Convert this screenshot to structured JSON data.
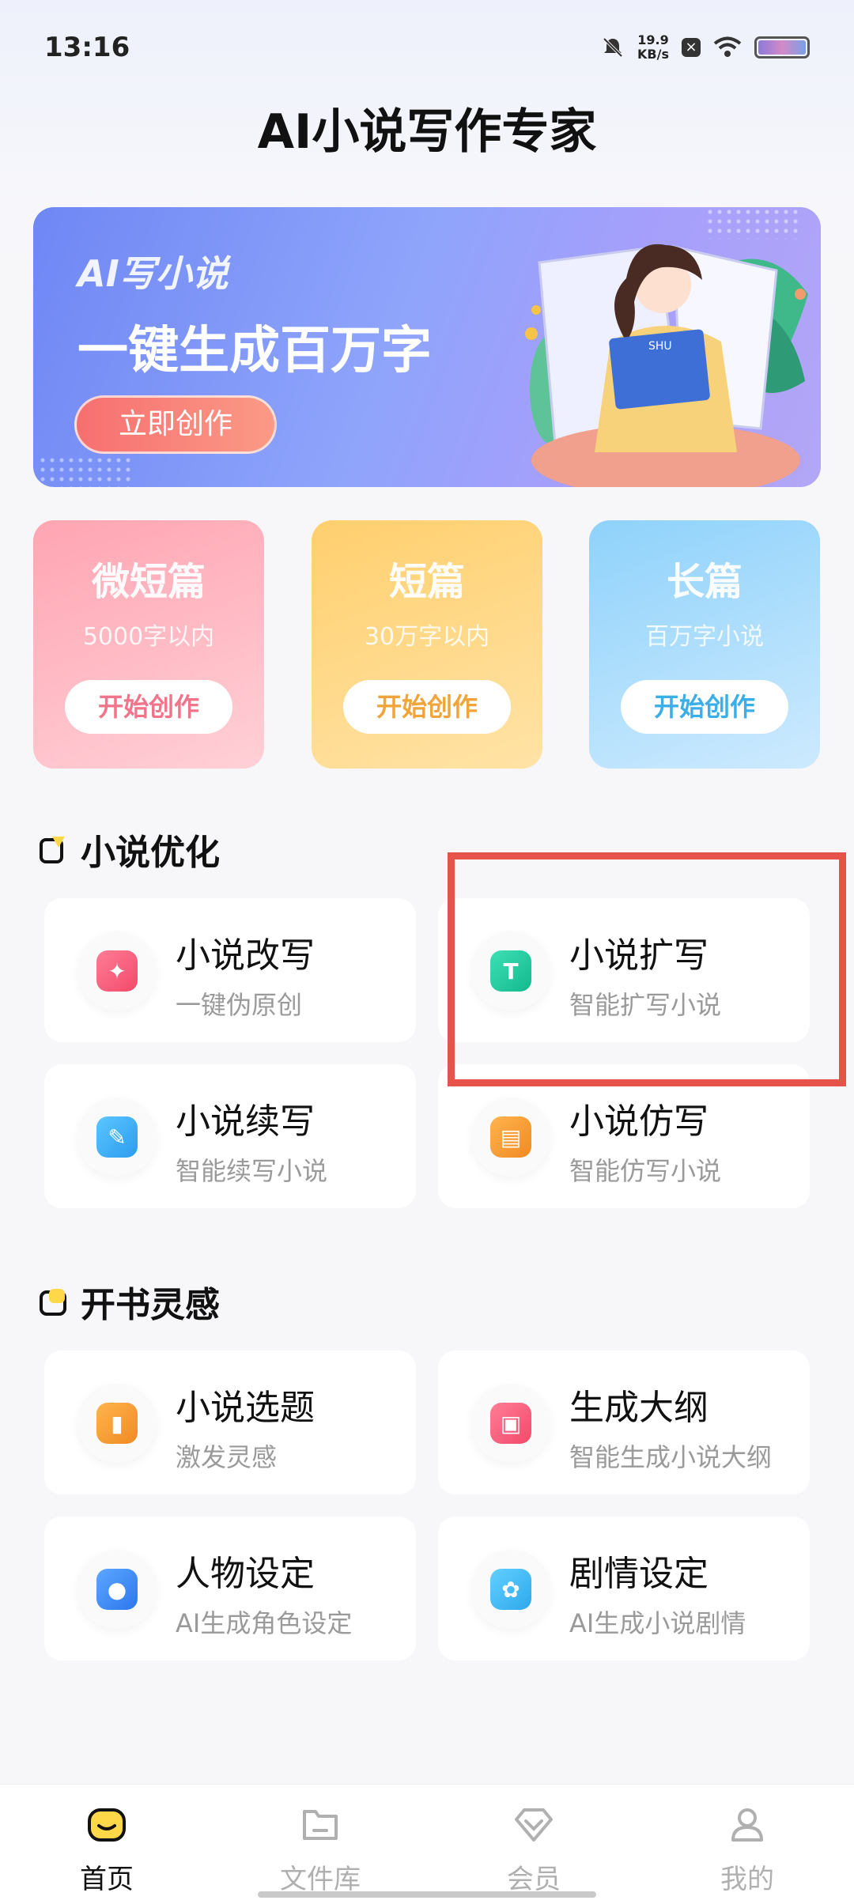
{
  "status_bar": {
    "time": "13:16",
    "net_speed_value": "19.9",
    "net_speed_unit": "KB/s"
  },
  "app_title": "AI小说写作专家",
  "banner": {
    "tag": "AI写小说",
    "headline": "一键生成百万字",
    "button": "立即创作"
  },
  "length_cards": [
    {
      "title": "微短篇",
      "subtitle": "5000字以内",
      "button": "开始创作",
      "accent": "#f2748a"
    },
    {
      "title": "短篇",
      "subtitle": "30万字以内",
      "button": "开始创作",
      "accent": "#f0a43a"
    },
    {
      "title": "长篇",
      "subtitle": "百万字小说",
      "button": "开始创作",
      "accent": "#3aaee8"
    }
  ],
  "sections": [
    {
      "title": "小说优化",
      "items": [
        {
          "title": "小说改写",
          "subtitle": "一键伪原创",
          "icon": "bulb-icon"
        },
        {
          "title": "小说扩写",
          "subtitle": "智能扩写小说",
          "icon": "expand-text-icon"
        },
        {
          "title": "小说续写",
          "subtitle": "智能续写小说",
          "icon": "pen-icon"
        },
        {
          "title": "小说仿写",
          "subtitle": "智能仿写小说",
          "icon": "copy-icon"
        }
      ]
    },
    {
      "title": "开书灵感",
      "items": [
        {
          "title": "小说选题",
          "subtitle": "激发灵感",
          "icon": "book-icon"
        },
        {
          "title": "生成大纲",
          "subtitle": "智能生成小说大纲",
          "icon": "outline-icon"
        },
        {
          "title": "人物设定",
          "subtitle": "AI生成角色设定",
          "icon": "person-icon"
        },
        {
          "title": "剧情设定",
          "subtitle": "AI生成小说剧情",
          "icon": "gear-icon"
        }
      ]
    }
  ],
  "bottom_nav": [
    {
      "label": "首页",
      "active": true
    },
    {
      "label": "文件库",
      "active": false
    },
    {
      "label": "会员",
      "active": false
    },
    {
      "label": "我的",
      "active": false
    }
  ],
  "colors": {
    "highlight": "#e5534b",
    "brand_yellow": "#ffd84a"
  }
}
